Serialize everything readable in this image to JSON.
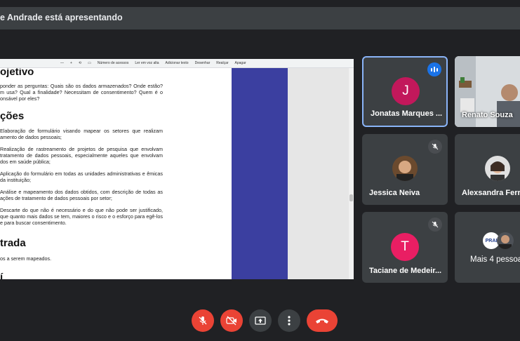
{
  "presenter_bar": {
    "text": "e Andrade está apresentando"
  },
  "pdf_toolbar": {
    "items": [
      "—",
      "+",
      "⟲",
      "▭",
      "Número de acessos",
      "Ler em voz alta",
      "Adicionar texto",
      "Desenhar",
      "Realçar",
      "Apagar"
    ]
  },
  "document": {
    "heading_objetivo": "ojetivo",
    "objetivo_text": "ponder as perguntas: Quais são os dados armazenados? Onde estão? m usa? Qual a finalidade? Necessitam de consentimento? Quem é o onsável por eles?",
    "heading_acoes": "ções",
    "acoes_items": [
      "Elaboração de formulário visando mapear os setores que realizam amento de dados pessoais;",
      "Realização de rastreamento de projetos de pesquisa que envolvam tratamento de dados pessoais, especialmente aqueles que envolvam dos em saúde pública;",
      "Aplicação do formulário em todas as unidades administrativas e êmicas da instituição;",
      "Análise e mapeamento dos dados obtidos, com descrição de todas as ações de tratamento de dados pessoais por setor;",
      "Descarte do que não é necessário e do que não pode ser justificado, que quanto mais dados se tem, maiores o risco e o esforço para egê-los e para buscar consentimento."
    ],
    "heading_entrada": "trada",
    "entrada_text": "os a serem mapeados.",
    "heading_cut": "í"
  },
  "participants": {
    "jonatas": {
      "name": "Jonatas Marques ...",
      "initial": "J",
      "color": "#c2185b"
    },
    "renato": {
      "name": "Renato Souza"
    },
    "jessica": {
      "name": "Jessica Neiva"
    },
    "alexsandra": {
      "name": "Alexsandra Ferr"
    },
    "taciane": {
      "name": "Taciane de Medeir...",
      "initial": "T",
      "color": "#e91e63"
    },
    "more": {
      "label": "Mais 4 pessoa",
      "badge": "PRAI"
    }
  },
  "colors": {
    "accent": "#8ab4f8",
    "danger": "#ea4335",
    "speaking": "#1a73e8"
  }
}
